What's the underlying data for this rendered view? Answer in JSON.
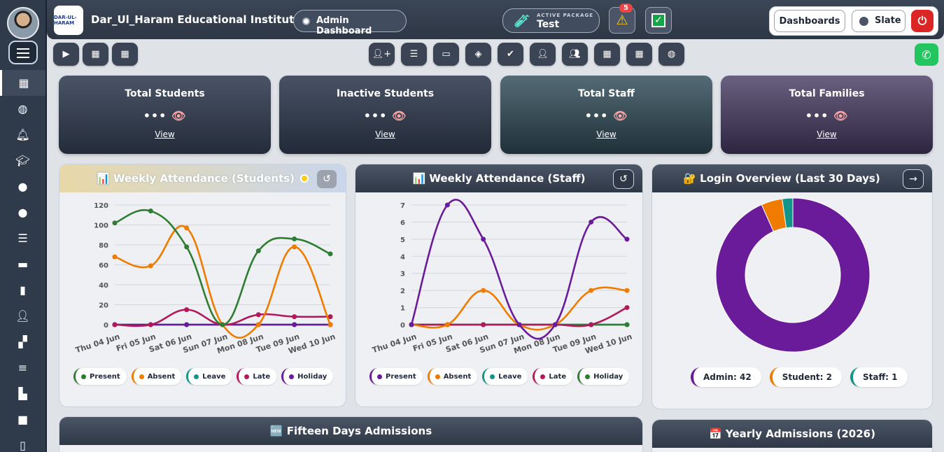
{
  "header": {
    "logo_text": "DAR-UL-HARAM",
    "institute_name": "Dar_Ul_Haram Educational Institute",
    "admin_dashboard_label": "Admin Dashboard",
    "package_label": "ACTIVE PACKAGE",
    "package_value": "Test",
    "warning_count": "5",
    "dashboards_label": "Dashboards",
    "theme_label": "Slate"
  },
  "stats": [
    {
      "title": "Total Students",
      "value": "•••",
      "link": "View",
      "color": "#2f3a4c"
    },
    {
      "title": "Inactive Students",
      "value": "•••",
      "link": "View",
      "color": "#2d374a"
    },
    {
      "title": "Total Staff",
      "value": "•••",
      "link": "View",
      "color": "#2b4550"
    },
    {
      "title": "Total Families",
      "value": "•••",
      "link": "View",
      "color": "#3b3350"
    }
  ],
  "panels": {
    "students_title": "📊 Weekly Attendance (Students)",
    "staff_title": "📊 Weekly Attendance (Staff)",
    "login_title": "🔐 Login Overview (Last 30 Days)",
    "fifteen_title": "🆕 Fifteen Days Admissions",
    "yearly_title": "📅 Yearly Admissions (2026)"
  },
  "legend_labels": [
    "Present",
    "Absent",
    "Leave",
    "Late",
    "Holiday"
  ],
  "login_legend": {
    "admin": "Admin: 42",
    "student": "Student: 2",
    "staff": "Staff: 1"
  },
  "chart_data": [
    {
      "type": "line",
      "title": "Weekly Attendance (Students)",
      "categories": [
        "Thu 04 Jun",
        "Fri 05 Jun",
        "Sat 06 Jun",
        "Sun 07 Jun",
        "Mon 08 Jun",
        "Tue 09 Jun",
        "Wed 10 Jun"
      ],
      "ylim": [
        0,
        120
      ],
      "yticks": [
        0,
        20,
        40,
        60,
        80,
        100,
        120
      ],
      "series": [
        {
          "name": "Present",
          "color": "#2e7d32",
          "values": [
            102,
            114,
            78,
            0,
            74,
            86,
            71
          ]
        },
        {
          "name": "Absent",
          "color": "#ef7c00",
          "values": [
            68,
            59,
            97,
            0,
            0,
            78,
            0
          ]
        },
        {
          "name": "Leave",
          "color": "#129488",
          "values": [
            0,
            0,
            0,
            0,
            0,
            0,
            0
          ]
        },
        {
          "name": "Late",
          "color": "#b0195a",
          "values": [
            0,
            0,
            15,
            0,
            10,
            8,
            8
          ]
        },
        {
          "name": "Holiday",
          "color": "#6a1b9a",
          "values": [
            0,
            0,
            0,
            0,
            0,
            0,
            0
          ]
        }
      ]
    },
    {
      "type": "line",
      "title": "Weekly Attendance (Staff)",
      "categories": [
        "Thu 04 Jun",
        "Fri 05 Jun",
        "Sat 06 Jun",
        "Sun 07 Jun",
        "Mon 08 Jun",
        "Tue 09 Jun",
        "Wed 10 Jun"
      ],
      "ylim": [
        0,
        7
      ],
      "yticks": [
        0,
        1,
        2,
        3,
        4,
        5,
        6,
        7
      ],
      "series": [
        {
          "name": "Present",
          "color": "#6a1b9a",
          "values": [
            0,
            7,
            5,
            0,
            0,
            6,
            5
          ]
        },
        {
          "name": "Absent",
          "color": "#ef7c00",
          "values": [
            0,
            0,
            2,
            0,
            0,
            2,
            2
          ]
        },
        {
          "name": "Leave",
          "color": "#129488",
          "values": [
            0,
            0,
            0,
            0,
            0,
            0,
            0
          ]
        },
        {
          "name": "Late",
          "color": "#b0195a",
          "values": [
            0,
            0,
            0,
            0,
            0,
            0,
            1
          ]
        },
        {
          "name": "Holiday",
          "color": "#2e7d32",
          "values": [
            0,
            0,
            0,
            0,
            0,
            0,
            0
          ]
        }
      ]
    },
    {
      "type": "pie",
      "title": "Login Overview (Last 30 Days)",
      "categories": [
        "Admin",
        "Student",
        "Staff"
      ],
      "values": [
        42,
        2,
        1
      ],
      "colors": [
        "#6a1b9a",
        "#ef7c00",
        "#129488"
      ]
    }
  ]
}
